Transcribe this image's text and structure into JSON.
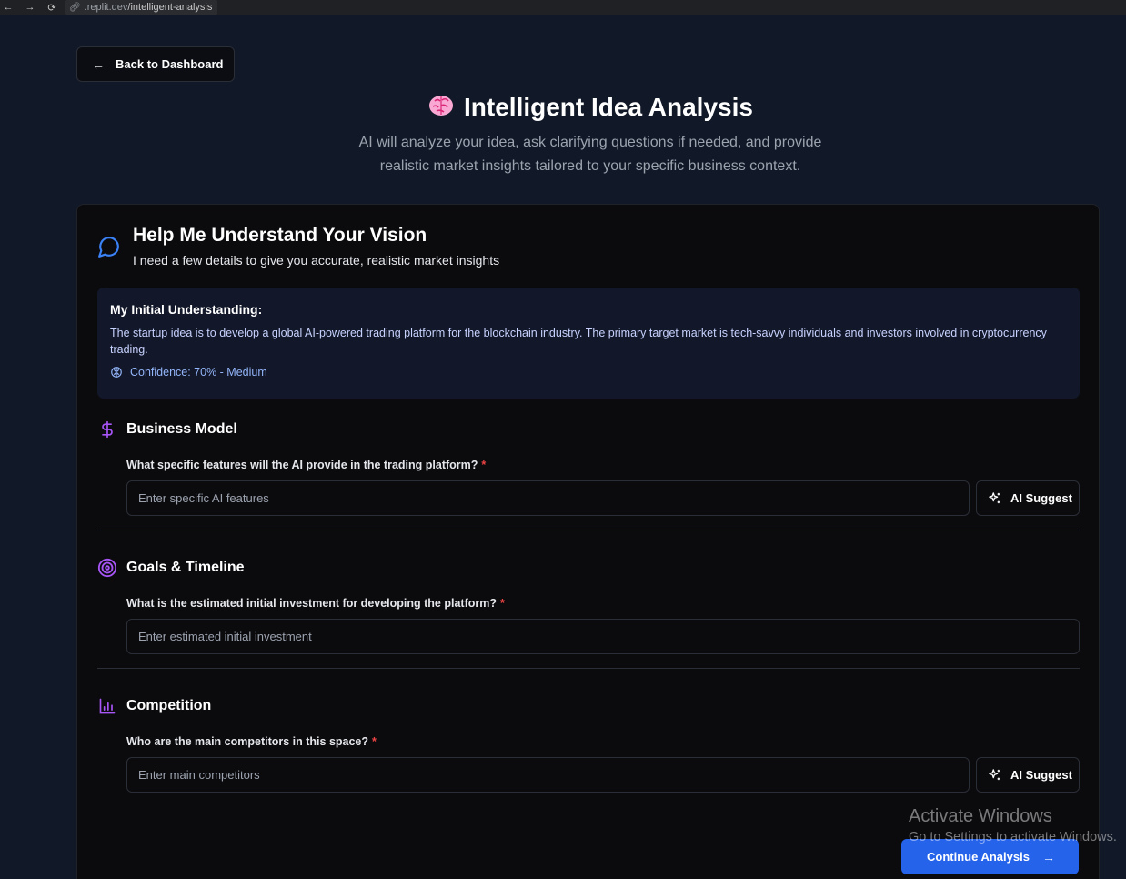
{
  "browser": {
    "url_dim": ".replit.dev",
    "url_path": "/intelligent-analysis"
  },
  "header": {
    "back_label": "Back to Dashboard",
    "title": "Intelligent Idea Analysis",
    "subtitle": "AI will analyze your idea, ask clarifying questions if needed, and provide realistic market insights tailored to your specific business context."
  },
  "card": {
    "title": "Help Me Understand Your Vision",
    "subtitle": "I need a few details to give you accurate, realistic market insights",
    "understanding": {
      "heading": "My Initial Understanding:",
      "text": "The startup idea is to develop a global AI-powered trading platform for the blockchain industry. The primary target market is tech-savvy individuals and investors involved in cryptocurrency trading.",
      "confidence": "Confidence: 70% - Medium"
    },
    "sections": [
      {
        "title": "Business Model",
        "question": "What specific features will the AI provide in the trading platform?",
        "placeholder": "Enter specific AI features",
        "suggest_label": "AI Suggest"
      },
      {
        "title": "Goals & Timeline",
        "question": "What is the estimated initial investment for developing the platform?",
        "placeholder": "Enter estimated initial investment"
      },
      {
        "title": "Competition",
        "question": "Who are the main competitors in this space?",
        "placeholder": "Enter main competitors",
        "suggest_label": "AI Suggest"
      }
    ],
    "required_mark": "*"
  },
  "footer": {
    "continue_label": "Continue Analysis"
  },
  "watermark": {
    "line1": "Activate Windows",
    "line2": "Go to Settings to activate Windows."
  },
  "colors": {
    "accent": "#2563eb",
    "section_icon": "#a855f7",
    "chat_icon": "#3b82f6",
    "required": "#ef4444"
  }
}
